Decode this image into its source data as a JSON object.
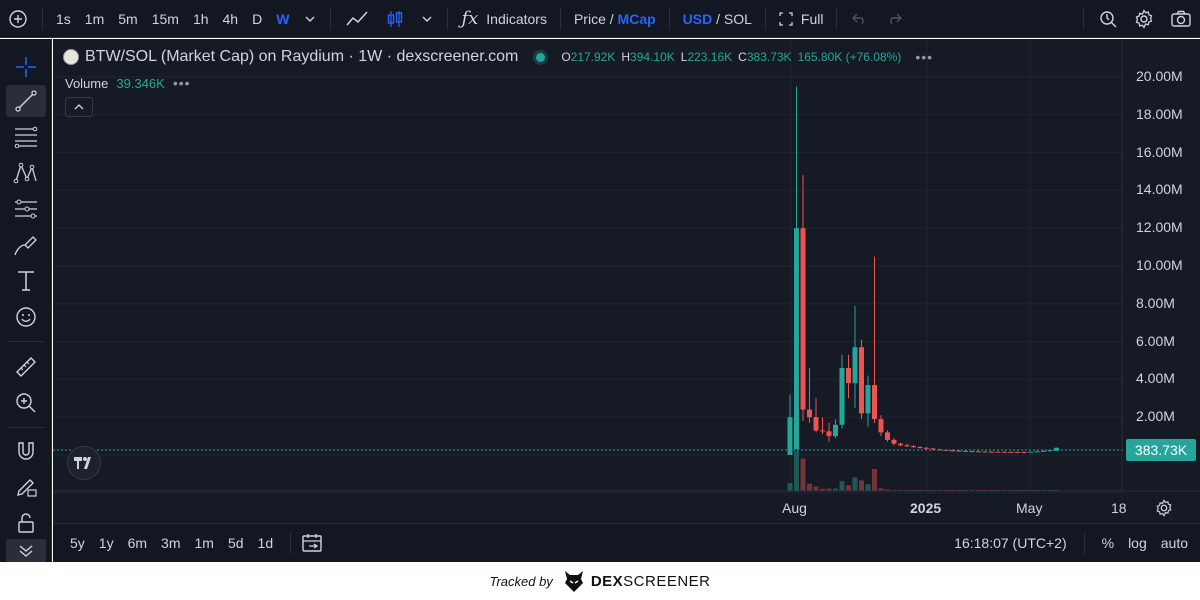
{
  "toolbar": {
    "intervals": [
      "1s",
      "1m",
      "5m",
      "15m",
      "1h",
      "4h",
      "D",
      "W"
    ],
    "active_interval": "W",
    "indicators_label": "Indicators",
    "price_label": "Price /",
    "mcap_label": "MCap",
    "usd_label": "USD",
    "sol_label": "/ SOL",
    "full_label": "Full"
  },
  "legend": {
    "title": "BTW/SOL (Market Cap) on Raydium · 1W · dexscreener.com",
    "o_key": "O",
    "o_val": "217.92K",
    "h_key": "H",
    "h_val": "394.10K",
    "l_key": "L",
    "l_val": "223.16K",
    "c_key": "C",
    "c_val": "383.73K",
    "change": "165.80K (+76.08%)",
    "volume_label": "Volume",
    "volume_value": "39.346K"
  },
  "price_axis": {
    "labels": [
      "20.00M",
      "18.00M",
      "16.00M",
      "14.00M",
      "12.00M",
      "10.00M",
      "8.00M",
      "6.00M",
      "4.00M",
      "2.00M"
    ],
    "current": "383.73K"
  },
  "time_axis": {
    "labels": [
      "Aug",
      "2025",
      "May",
      "18"
    ]
  },
  "bottom": {
    "ranges": [
      "5y",
      "1y",
      "6m",
      "3m",
      "1m",
      "5d",
      "1d"
    ],
    "time": "16:18:07 (UTC+2)",
    "percent": "%",
    "log": "log",
    "auto": "auto"
  },
  "footer": {
    "tracked_by": "Tracked by",
    "brand_a": "DEX",
    "brand_b": "SCREENER"
  },
  "colors": {
    "up": "#26a69a",
    "down": "#ef5350",
    "accent": "#2962ff",
    "background": "#161a25"
  },
  "chart_data": {
    "type": "candlestick",
    "ylim": [
      0,
      21000000
    ],
    "candles": [
      {
        "o": 0,
        "h": 3200000,
        "l": 0,
        "c": 2000000
      },
      {
        "o": 300000,
        "h": 19500000,
        "l": 300000,
        "c": 12000000
      },
      {
        "o": 12000000,
        "h": 14800000,
        "l": 1800000,
        "c": 2400000
      },
      {
        "o": 2400000,
        "h": 4600000,
        "l": 1700000,
        "c": 2000000
      },
      {
        "o": 2000000,
        "h": 3000000,
        "l": 1200000,
        "c": 1300000
      },
      {
        "o": 1300000,
        "h": 2000000,
        "l": 1100000,
        "c": 1250000
      },
      {
        "o": 1250000,
        "h": 1700000,
        "l": 700000,
        "c": 1000000
      },
      {
        "o": 1000000,
        "h": 1900000,
        "l": 900000,
        "c": 1600000
      },
      {
        "o": 1600000,
        "h": 5300000,
        "l": 1400000,
        "c": 4600000
      },
      {
        "o": 4600000,
        "h": 5300000,
        "l": 3000000,
        "c": 3800000
      },
      {
        "o": 3800000,
        "h": 7900000,
        "l": 2500000,
        "c": 5700000
      },
      {
        "o": 5700000,
        "h": 6100000,
        "l": 1900000,
        "c": 2200000
      },
      {
        "o": 2200000,
        "h": 4200000,
        "l": 1500000,
        "c": 3700000
      },
      {
        "o": 3700000,
        "h": 10500000,
        "l": 1700000,
        "c": 1900000
      },
      {
        "o": 1900000,
        "h": 2100000,
        "l": 1000000,
        "c": 1200000
      },
      {
        "o": 1200000,
        "h": 1300000,
        "l": 700000,
        "c": 800000
      },
      {
        "o": 800000,
        "h": 900000,
        "l": 500000,
        "c": 600000
      },
      {
        "o": 600000,
        "h": 650000,
        "l": 450000,
        "c": 520000
      },
      {
        "o": 520000,
        "h": 600000,
        "l": 420000,
        "c": 470000
      },
      {
        "o": 470000,
        "h": 520000,
        "l": 380000,
        "c": 420000
      },
      {
        "o": 420000,
        "h": 460000,
        "l": 340000,
        "c": 380000
      },
      {
        "o": 380000,
        "h": 420000,
        "l": 300000,
        "c": 340000
      },
      {
        "o": 340000,
        "h": 380000,
        "l": 270000,
        "c": 300000
      },
      {
        "o": 300000,
        "h": 340000,
        "l": 240000,
        "c": 270000
      },
      {
        "o": 270000,
        "h": 300000,
        "l": 220000,
        "c": 250000
      },
      {
        "o": 250000,
        "h": 280000,
        "l": 200000,
        "c": 230000
      },
      {
        "o": 230000,
        "h": 260000,
        "l": 190000,
        "c": 215000
      },
      {
        "o": 215000,
        "h": 240000,
        "l": 180000,
        "c": 205000
      },
      {
        "o": 205000,
        "h": 230000,
        "l": 170000,
        "c": 195000
      },
      {
        "o": 195000,
        "h": 220000,
        "l": 165000,
        "c": 185000
      },
      {
        "o": 185000,
        "h": 210000,
        "l": 160000,
        "c": 178000
      },
      {
        "o": 178000,
        "h": 200000,
        "l": 155000,
        "c": 172000
      },
      {
        "o": 172000,
        "h": 195000,
        "l": 150000,
        "c": 168000
      },
      {
        "o": 168000,
        "h": 190000,
        "l": 148000,
        "c": 165000
      },
      {
        "o": 165000,
        "h": 188000,
        "l": 145000,
        "c": 162000
      },
      {
        "o": 162000,
        "h": 185000,
        "l": 140000,
        "c": 160000
      },
      {
        "o": 160000,
        "h": 182000,
        "l": 138000,
        "c": 158000
      },
      {
        "o": 158000,
        "h": 190000,
        "l": 140000,
        "c": 175000
      },
      {
        "o": 175000,
        "h": 210000,
        "l": 160000,
        "c": 195000
      },
      {
        "o": 195000,
        "h": 240000,
        "l": 180000,
        "c": 220000
      },
      {
        "o": 220000,
        "h": 280000,
        "l": 200000,
        "c": 250000
      },
      {
        "o": 217920,
        "h": 394100,
        "l": 223160,
        "c": 383730
      }
    ]
  }
}
